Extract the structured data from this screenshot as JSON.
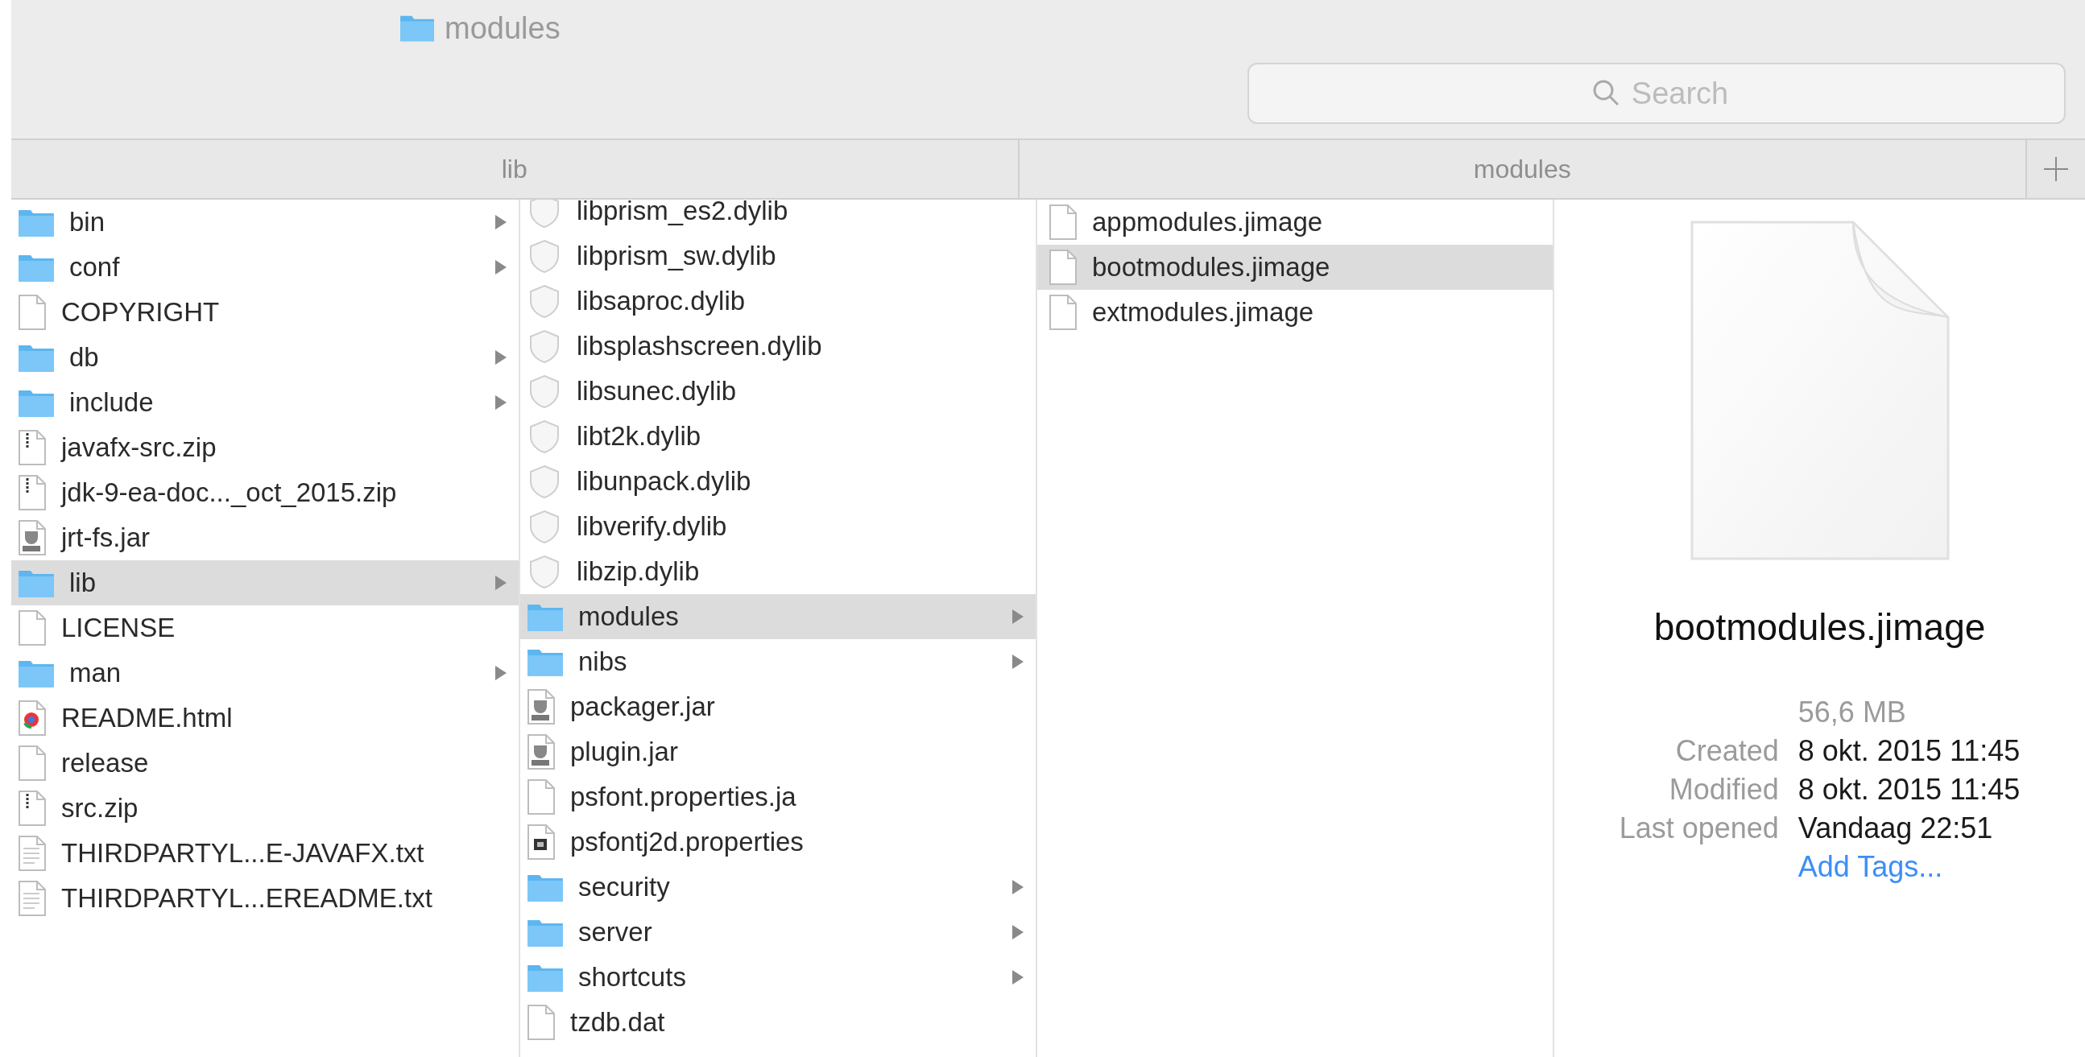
{
  "window": {
    "title": "modules"
  },
  "search": {
    "placeholder": "Search"
  },
  "path_tabs": [
    {
      "label": "lib"
    },
    {
      "label": "modules"
    }
  ],
  "columns": [
    {
      "items": [
        {
          "name": "bin",
          "kind": "folder",
          "selected": false
        },
        {
          "name": "conf",
          "kind": "folder",
          "selected": false
        },
        {
          "name": "COPYRIGHT",
          "kind": "document",
          "selected": false
        },
        {
          "name": "db",
          "kind": "folder",
          "selected": false
        },
        {
          "name": "include",
          "kind": "folder",
          "selected": false
        },
        {
          "name": "javafx-src.zip",
          "kind": "archive",
          "selected": false
        },
        {
          "name": "jdk-9-ea-doc..._oct_2015.zip",
          "kind": "archive",
          "selected": false
        },
        {
          "name": "jrt-fs.jar",
          "kind": "jar",
          "selected": false
        },
        {
          "name": "lib",
          "kind": "folder",
          "selected": true
        },
        {
          "name": "LICENSE",
          "kind": "document",
          "selected": false
        },
        {
          "name": "man",
          "kind": "folder",
          "selected": false
        },
        {
          "name": "README.html",
          "kind": "webpage",
          "selected": false
        },
        {
          "name": "release",
          "kind": "document",
          "selected": false
        },
        {
          "name": "src.zip",
          "kind": "archive",
          "selected": false
        },
        {
          "name": "THIRDPARTYL...E-JAVAFX.txt",
          "kind": "text",
          "selected": false
        },
        {
          "name": "THIRDPARTYL...EREADME.txt",
          "kind": "text",
          "selected": false
        }
      ]
    },
    {
      "items": [
        {
          "name": "libprism_es2.dylib",
          "kind": "library",
          "selected": false
        },
        {
          "name": "libprism_sw.dylib",
          "kind": "library",
          "selected": false
        },
        {
          "name": "libsaproc.dylib",
          "kind": "library",
          "selected": false
        },
        {
          "name": "libsplashscreen.dylib",
          "kind": "library",
          "selected": false
        },
        {
          "name": "libsunec.dylib",
          "kind": "library",
          "selected": false
        },
        {
          "name": "libt2k.dylib",
          "kind": "library",
          "selected": false
        },
        {
          "name": "libunpack.dylib",
          "kind": "library",
          "selected": false
        },
        {
          "name": "libverify.dylib",
          "kind": "library",
          "selected": false
        },
        {
          "name": "libzip.dylib",
          "kind": "library",
          "selected": false
        },
        {
          "name": "modules",
          "kind": "folder",
          "selected": true
        },
        {
          "name": "nibs",
          "kind": "folder",
          "selected": false
        },
        {
          "name": "packager.jar",
          "kind": "jar",
          "selected": false
        },
        {
          "name": "plugin.jar",
          "kind": "jar",
          "selected": false
        },
        {
          "name": "psfont.properties.ja",
          "kind": "document",
          "selected": false
        },
        {
          "name": "psfontj2d.properties",
          "kind": "binary",
          "selected": false
        },
        {
          "name": "security",
          "kind": "folder",
          "selected": false
        },
        {
          "name": "server",
          "kind": "folder",
          "selected": false
        },
        {
          "name": "shortcuts",
          "kind": "folder",
          "selected": false
        },
        {
          "name": "tzdb.dat",
          "kind": "document",
          "selected": false
        }
      ]
    },
    {
      "items": [
        {
          "name": "appmodules.jimage",
          "kind": "document",
          "selected": false
        },
        {
          "name": "bootmodules.jimage",
          "kind": "document",
          "selected": true
        },
        {
          "name": "extmodules.jimage",
          "kind": "document",
          "selected": false
        }
      ]
    }
  ],
  "preview": {
    "name": "bootmodules.jimage",
    "size": "56,6 MB",
    "info": [
      {
        "label": "Created",
        "value": "8 okt. 2015 11:45"
      },
      {
        "label": "Modified",
        "value": "8 okt. 2015 11:45"
      },
      {
        "label": "Last opened",
        "value": "Vandaag 22:51"
      }
    ],
    "link": "Add Tags..."
  }
}
